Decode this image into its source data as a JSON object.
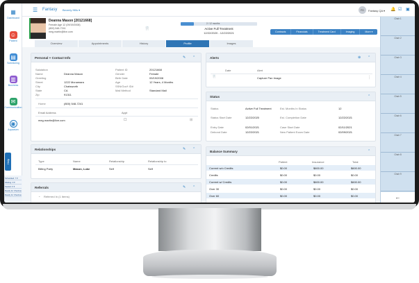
{
  "sidebar": {
    "items": [
      {
        "label": "Dashboard",
        "icon": "dashboard-icon"
      },
      {
        "label": "Patient",
        "icon": "patient-icon"
      },
      {
        "label": "Scheduling",
        "icon": "calendar-icon"
      },
      {
        "label": "Business",
        "icon": "business-icon"
      },
      {
        "label": "Communication",
        "icon": "communication-icon"
      },
      {
        "label": "Aquarium",
        "icon": "aquarium-icon"
      }
    ],
    "help_label": "Help",
    "schedule": [
      "Scheduled: 7 ▾",
      "Waiting: 0 ▾",
      "Seated: 0 ▾",
      "Ready for Checkout: 0 ▾",
      "Ready for Checkout: 0 ▾"
    ]
  },
  "topbar": {
    "app_title": "Fantasy",
    "location": "Beverly Hills ▾",
    "user_initials": "FD",
    "user_name": "Fantasy QA ▾"
  },
  "patient": {
    "name": "Deanna Mason [20121668]",
    "age_line": "Female Age 12 (09/19/2008)",
    "phone": "(800) 548-7241",
    "email": "meg.martin@live.com",
    "progress_text": "2 / 12 months",
    "progress_fraction": 0.17,
    "treatment_title": "Active Full Treatment",
    "treatment_dates": "12/22/2020 - 12/22/2021",
    "actions": [
      "Contracts",
      "Financials",
      "Treatment Card",
      "Imaging",
      "More ▾"
    ]
  },
  "tabs": [
    "Overview",
    "Appointments",
    "History",
    "Profile",
    "Images"
  ],
  "active_tab": "Profile",
  "chairs": [
    "Chair 1",
    "Chair 2",
    "Chair 3",
    "Chair 4",
    "Chair 5",
    "Chair 6",
    "Chair 7",
    "Chair 8",
    "Chair 9"
  ],
  "personal": {
    "title": "Personal + Contact Info",
    "left": [
      {
        "label": "Salutation",
        "value": ""
      },
      {
        "label": "Name",
        "value": "Deanna Mason"
      },
      {
        "label": "Greeting",
        "value": ""
      },
      {
        "label": "Street",
        "value": "1222 Mcnamara"
      },
      {
        "label": "City",
        "value": "Chatsworth"
      },
      {
        "label": "State",
        "value": "CA"
      },
      {
        "label": "Zip",
        "value": "91311"
      }
    ],
    "right": [
      {
        "label": "Patient ID",
        "value": "20121668"
      },
      {
        "label": "Gender",
        "value": "Female"
      },
      {
        "label": "Birth Date",
        "value": "09/19/2008"
      },
      {
        "label": "Age",
        "value": "12 Years, 4 Months"
      },
      {
        "label": "SSN/Gov't ID#",
        "value": ""
      },
      {
        "label": "Mail Method",
        "value": "Standard Mail"
      }
    ],
    "home_label": "Home",
    "home_phone": "(800) 548-7241",
    "email_header": "Email Address",
    "appt_header": "Appt",
    "email_value": "meg.martin@live.com"
  },
  "relationships": {
    "title": "Relationships",
    "headers": [
      "Type",
      "Name",
      "Relationship",
      "Relationship to"
    ],
    "row": [
      "Billing Party",
      "Mason, Luke",
      "Self",
      "Self"
    ]
  },
  "referrals": {
    "title": "Referrals",
    "item": "Referred In (1 Items)"
  },
  "alerts": {
    "title": "Alerts",
    "headers": [
      "Date",
      "Alert"
    ],
    "row": {
      "date": "",
      "alert": "Capture Pan Image"
    }
  },
  "status": {
    "title": "Status",
    "left": [
      {
        "label": "Status",
        "value": "Active Full Treatment"
      },
      {
        "label": "Status Start Date",
        "value": "12/22/2020"
      },
      {
        "label": "Entry Date",
        "value": "02/01/2021"
      },
      {
        "label": "Debond Date",
        "value": "12/22/2021"
      }
    ],
    "right": [
      {
        "label": "Est. Months In Status",
        "value": "12"
      },
      {
        "label": "Est. Completion Date",
        "value": "12/22/2021"
      },
      {
        "label": "Case Start Date",
        "value": "02/11/2021"
      },
      {
        "label": "New Patient Exam Date",
        "value": "02/09/2021"
      }
    ]
  },
  "balance": {
    "title": "Balance Summary",
    "headers": [
      "Patient",
      "Insurance",
      "Total"
    ],
    "rows": [
      {
        "label": "Current w/o Credits",
        "patient": "$0.00",
        "insurance": "$600.00",
        "total": "$600.00"
      },
      {
        "label": "Credits",
        "patient": "$0.00",
        "insurance": "$0.00",
        "total": "$0.00"
      },
      {
        "label": "Current w/ Credits",
        "patient": "$0.00",
        "insurance": "$600.00",
        "total": "$600.00"
      },
      {
        "label": "Over 30",
        "patient": "$0.00",
        "insurance": "$0.00",
        "total": "$0.00"
      },
      {
        "label": "Over 60",
        "patient": "$0.00",
        "insurance": "$0.00",
        "total": "$0.00"
      }
    ]
  },
  "colors": {
    "accent": "#2a7fc4",
    "tab_active": "#2f75b5",
    "chair_panel": "#cfe0ef",
    "alt_row": "#e4eef8"
  }
}
